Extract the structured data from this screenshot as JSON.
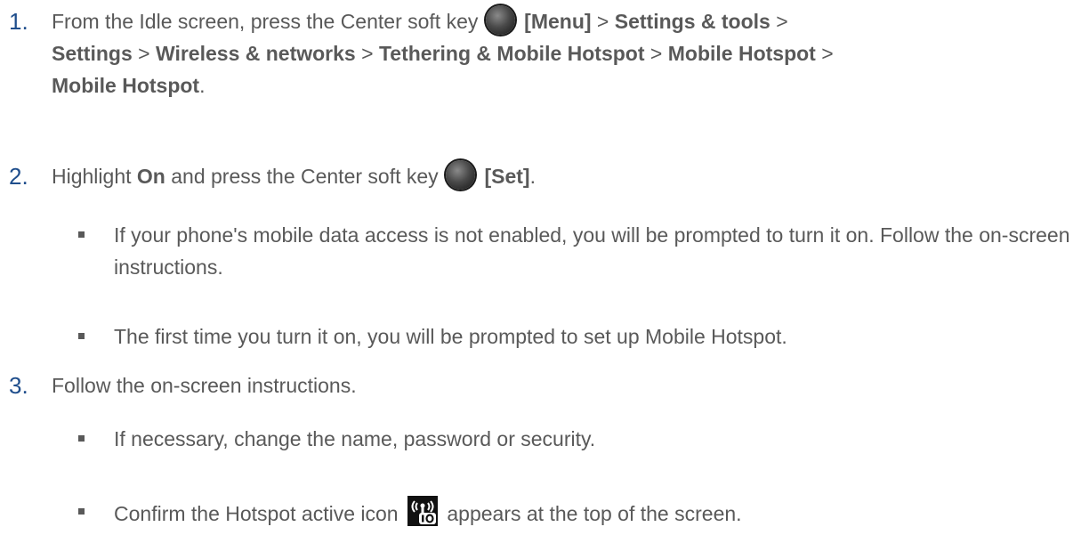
{
  "steps": [
    {
      "number": "1.",
      "intro": "From the Idle screen, press the Center soft key",
      "key_label": "[Menu]",
      "path": [
        {
          "sep": " > ",
          "item": "Settings & tools"
        },
        {
          "sep": " > ",
          "item": "Settings"
        },
        {
          "sep": " > ",
          "item": "Wireless & networks"
        },
        {
          "sep": " > ",
          "item": "Tethering & Mobile Hotspot"
        },
        {
          "sep": " > ",
          "item": "Mobile Hotspot"
        },
        {
          "sep": " > ",
          "item": "Mobile Hotspot"
        }
      ],
      "end": "."
    },
    {
      "number": "2.",
      "text_a": "Highlight ",
      "highlight": "On",
      "text_b": " and press the Center soft key",
      "key_label": "[Set]",
      "end": ".",
      "bullets": [
        {
          "text": "If your phone's mobile data access is not enabled, you will be prompted to turn it on. Follow the on-screen instructions."
        },
        {
          "text": "The first time you turn it on, you will be prompted to set up Mobile Hotspot."
        }
      ]
    },
    {
      "number": "3.",
      "text": "Follow the on-screen instructions.",
      "bullets": [
        {
          "text": "If necessary, change the name, password or security."
        },
        {
          "text_a": "Confirm the Hotspot active icon",
          "icon": "hotspot-active-icon",
          "text_b": "appears at the top of the screen."
        }
      ]
    }
  ],
  "colors": {
    "body_text": "#595959",
    "step_number": "#1f4e8c",
    "key_dark": "#151515"
  }
}
